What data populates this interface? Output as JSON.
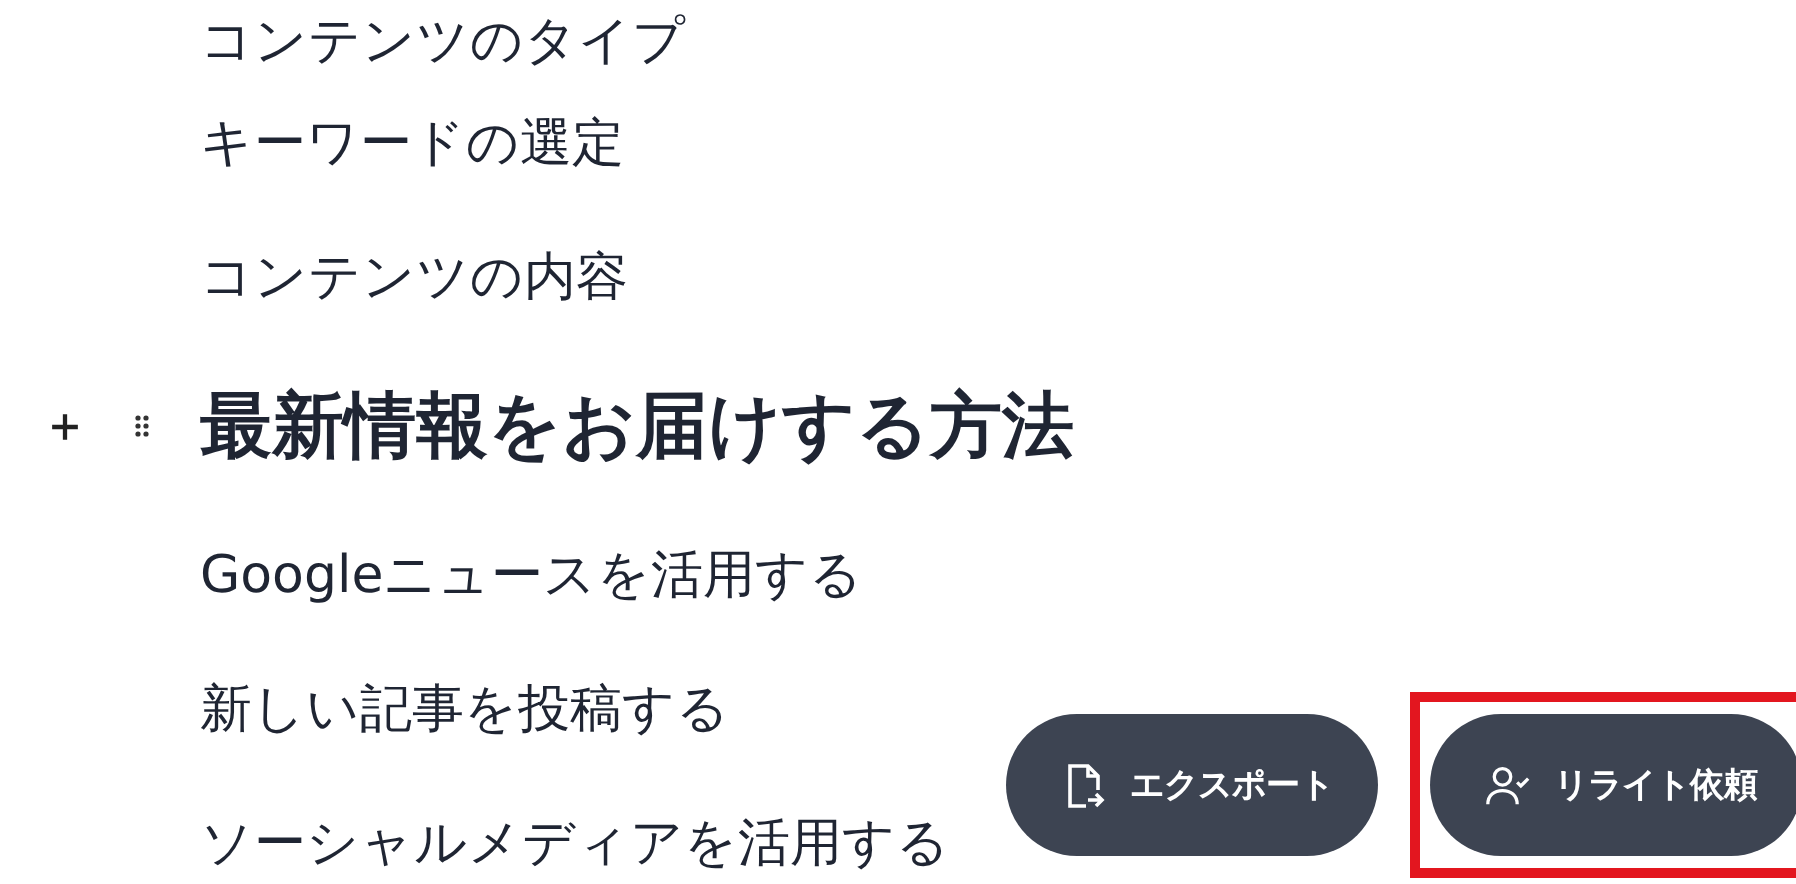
{
  "blocks": [
    {
      "kind": "item",
      "text": "コンテンツのタイプ"
    },
    {
      "kind": "item",
      "text": "キーワードの選定"
    },
    {
      "kind": "item",
      "text": "コンテンツの内容"
    },
    {
      "kind": "heading",
      "text": "最新情報をお届けする方法",
      "hovered": true
    },
    {
      "kind": "item",
      "text": "Googleニュースを活用する"
    },
    {
      "kind": "item",
      "text": "新しい記事を投稿する"
    },
    {
      "kind": "item",
      "text": "ソーシャルメディアを活用する"
    }
  ],
  "actions": [
    {
      "kind": "export",
      "label": "エクスポート",
      "highlighted": false
    },
    {
      "kind": "rewrite",
      "label": "リライト依頼",
      "highlighted": true
    }
  ]
}
